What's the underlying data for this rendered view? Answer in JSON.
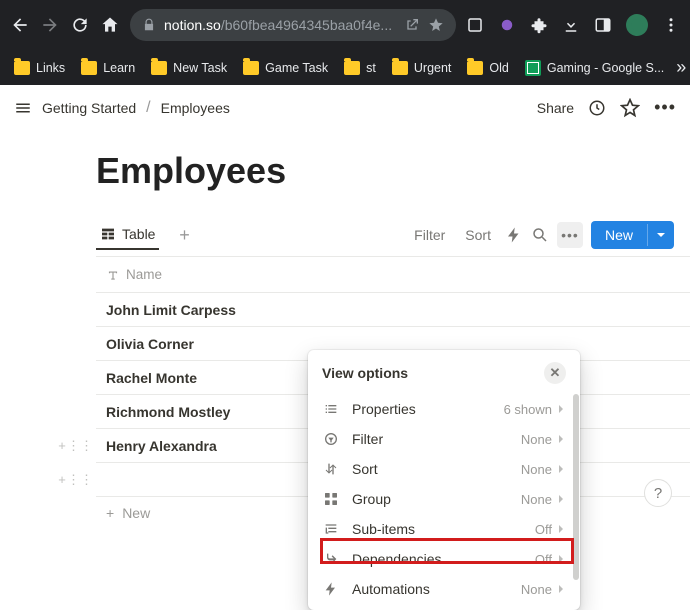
{
  "browser": {
    "url_domain": "notion.so",
    "url_path": "/b60fbea4964345baa0f4e...",
    "bookmarks": [
      {
        "label": "Links",
        "icon": "folder"
      },
      {
        "label": "Learn",
        "icon": "folder"
      },
      {
        "label": "New Task",
        "icon": "folder"
      },
      {
        "label": "Game Task",
        "icon": "folder"
      },
      {
        "label": "st",
        "icon": "folder"
      },
      {
        "label": "Urgent",
        "icon": "folder"
      },
      {
        "label": "Old",
        "icon": "folder"
      },
      {
        "label": "Gaming - Google S...",
        "icon": "sheet"
      }
    ]
  },
  "breadcrumb": {
    "root": "Getting Started",
    "current": "Employees"
  },
  "topbar": {
    "share": "Share"
  },
  "page": {
    "title": "Employees"
  },
  "viewbar": {
    "tab": "Table",
    "filter": "Filter",
    "sort": "Sort",
    "new": "New"
  },
  "table": {
    "name_header": "Name",
    "rows": [
      {
        "name": "John Limit Carpess"
      },
      {
        "name": "Olivia Corner"
      },
      {
        "name": "Rachel Monte"
      },
      {
        "name": "Richmond Mostley"
      },
      {
        "name": "Henry Alexandra"
      }
    ],
    "add_row": "New"
  },
  "popover": {
    "title": "View options",
    "items": [
      {
        "label": "Properties",
        "value": "6 shown",
        "icon": "list"
      },
      {
        "label": "Filter",
        "value": "None",
        "icon": "filter"
      },
      {
        "label": "Sort",
        "value": "None",
        "icon": "sort"
      },
      {
        "label": "Group",
        "value": "None",
        "icon": "group"
      },
      {
        "label": "Sub-items",
        "value": "Off",
        "icon": "subitems"
      },
      {
        "label": "Dependencies",
        "value": "Off",
        "icon": "dependencies"
      },
      {
        "label": "Automations",
        "value": "None",
        "icon": "bolt"
      }
    ]
  }
}
